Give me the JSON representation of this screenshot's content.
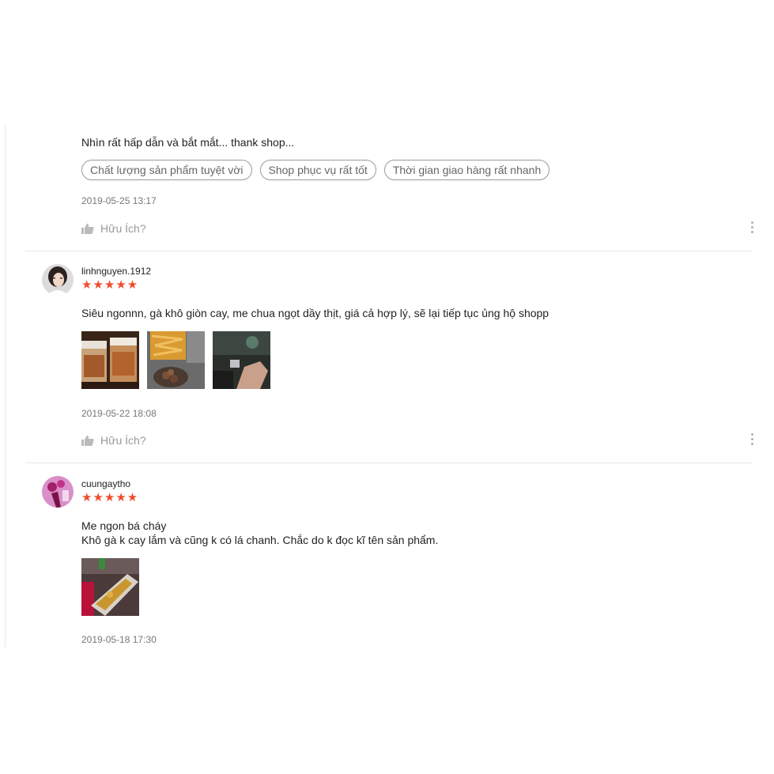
{
  "reviews": [
    {
      "comment": "Nhìn rất hấp dẫn và bắt mắt... thank shop...",
      "tags": [
        "Chất lượng sản phẩm tuyệt vời",
        "Shop phục vụ rất tốt",
        "Thời gian giao hàng rất nhanh"
      ],
      "date": "2019-05-25 13:17",
      "helpful_label": "Hữu Ích?"
    },
    {
      "username": "linhnguyen.1912",
      "rating": 5,
      "stars": "★★★★★",
      "comment": "Siêu ngonnn, gà khô giòn cay, me chua ngọt dầy thịt, giá cả hợp lý,  sẽ lại tiếp tục ủng hộ shopp",
      "photo_count": 3,
      "date": "2019-05-22 18:08",
      "helpful_label": "Hữu Ích?"
    },
    {
      "username": "cuungaytho",
      "rating": 5,
      "stars": "★★★★★",
      "comment": "Me ngon bá cháy\nKhô gà k cay lắm và cũng k có lá chanh. Chắc do k đọc kĩ tên sản phẩm.",
      "photo_count": 1,
      "date": "2019-05-18 17:30"
    }
  ],
  "colors": {
    "star": "#ee4d2d",
    "tag_border": "#9a9a9a",
    "muted": "#999999"
  },
  "icons": {
    "helpful": "thumbs-up-icon",
    "more": "more-vertical-icon"
  }
}
